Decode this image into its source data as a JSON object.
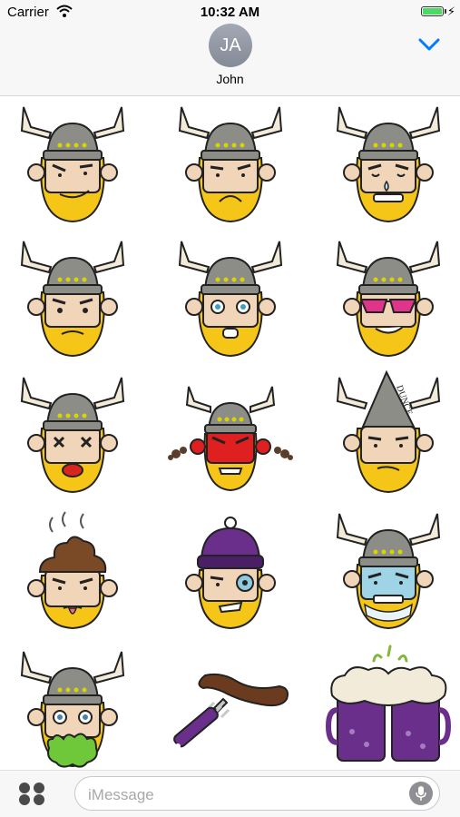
{
  "status_bar": {
    "carrier": "Carrier",
    "time": "10:32 AM",
    "battery_level": 1.0,
    "charging": true
  },
  "header": {
    "avatar_initials": "JA",
    "contact_name": "John"
  },
  "stickers": [
    {
      "label": "viking-smirk"
    },
    {
      "label": "viking-sad"
    },
    {
      "label": "viking-crying"
    },
    {
      "label": "viking-frown"
    },
    {
      "label": "viking-shocked"
    },
    {
      "label": "viking-sunglasses"
    },
    {
      "label": "viking-dizzy"
    },
    {
      "label": "viking-angry-red"
    },
    {
      "label": "viking-dunce-cap"
    },
    {
      "label": "viking-poop-hat"
    },
    {
      "label": "viking-beanie-bruised"
    },
    {
      "label": "viking-frozen"
    },
    {
      "label": "viking-vomit"
    },
    {
      "label": "sausage-on-fork"
    },
    {
      "label": "beer-mugs-cheers"
    }
  ],
  "dunce_text": "DUNCE",
  "input_bar": {
    "placeholder": "iMessage"
  },
  "colors": {
    "accent": "#007aff",
    "beard": "#f5c518",
    "helmet": "#8d8d88",
    "horn": "#f2ebd9"
  }
}
